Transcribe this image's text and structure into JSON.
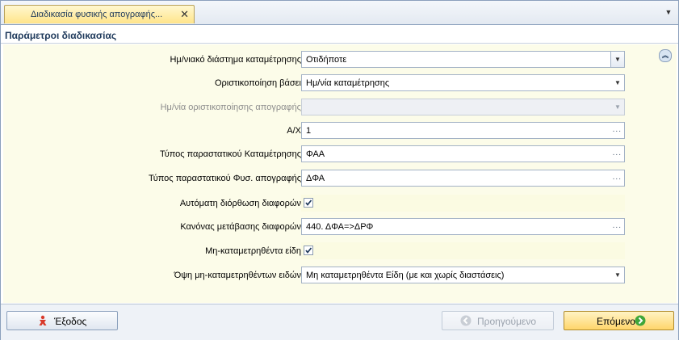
{
  "tab": {
    "title": "Διαδικασία φυσικής απογραφής...",
    "close": "✕"
  },
  "group": {
    "title": "Παράμετροι διαδικασίας"
  },
  "fields": [
    {
      "label": "Ημ/νιακό διάστημα καταμέτρησης",
      "value": "Οτιδήποτε",
      "type": "dropdown-boxed",
      "disabled": false
    },
    {
      "label": "Οριστικοποίηση βάσει",
      "value": "Ημ/νία καταμέτρησης",
      "type": "dropdown",
      "disabled": false
    },
    {
      "label": "Ημ/νία οριστικοποίησης απογραφής",
      "value": "",
      "type": "dropdown",
      "disabled": true
    },
    {
      "label": "Α/Χ",
      "value": "1",
      "type": "lookup",
      "disabled": false
    },
    {
      "label": "Τύπος παραστατικού Καταμέτρησης",
      "value": "ΦΑΑ",
      "type": "lookup",
      "disabled": false
    },
    {
      "label": "Τύπος παραστατικού Φυσ. απογραφής",
      "value": "ΔΦΑ",
      "type": "lookup",
      "disabled": false
    },
    {
      "label": "Αυτόματη διόρθωση διαφορών",
      "value": "checked",
      "type": "checkbox",
      "disabled": false
    },
    {
      "label": "Κανόνας μετάβασης διαφορών",
      "value": "440. ΔΦΑ=>ΔΡΦ",
      "type": "lookup",
      "disabled": false
    },
    {
      "label": "Μη-καταμετρηθέντα είδη",
      "value": "checked",
      "type": "checkbox",
      "disabled": false
    },
    {
      "label": "Όψη μη-καταμετρηθέντων ειδών",
      "value": "Μη καταμετρηθέντα Είδη (με και χωρίς διαστάσεις)",
      "type": "dropdown",
      "disabled": false
    }
  ],
  "buttons": {
    "exit": "Έξοδος",
    "prev": "Προηγούμενο",
    "next": "Επόμενο"
  },
  "colors": {
    "tab_bg": "#ffe48a",
    "panel_bg": "#fcfce9",
    "next_btn": "#ffd66b",
    "accent": "#1e395b"
  }
}
